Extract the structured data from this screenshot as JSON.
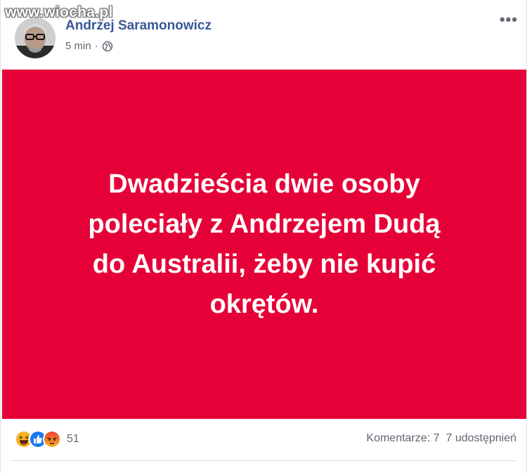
{
  "watermark": "www.wiocha.pl",
  "post": {
    "author": "Andrzej Saramonowicz",
    "time": "5 min",
    "separator": "·",
    "body_lines": [
      "Dwadzieścia dwie osoby",
      "poleciały z Andrzejem Dudą",
      "do Australii, żeby nie kupić",
      "okrętów."
    ],
    "background_color": "#e60038"
  },
  "footer": {
    "reactions": [
      {
        "name": "haha",
        "icon": "haha-reaction-icon"
      },
      {
        "name": "like",
        "icon": "like-reaction-icon"
      },
      {
        "name": "angry",
        "icon": "angry-reaction-icon"
      }
    ],
    "reaction_count": "51",
    "comments": "Komentarze: 7",
    "shares": "7 udostępnień"
  },
  "colors": {
    "author_link": "#385898",
    "meta_text": "#606770",
    "like_blue": "#1877f2"
  }
}
